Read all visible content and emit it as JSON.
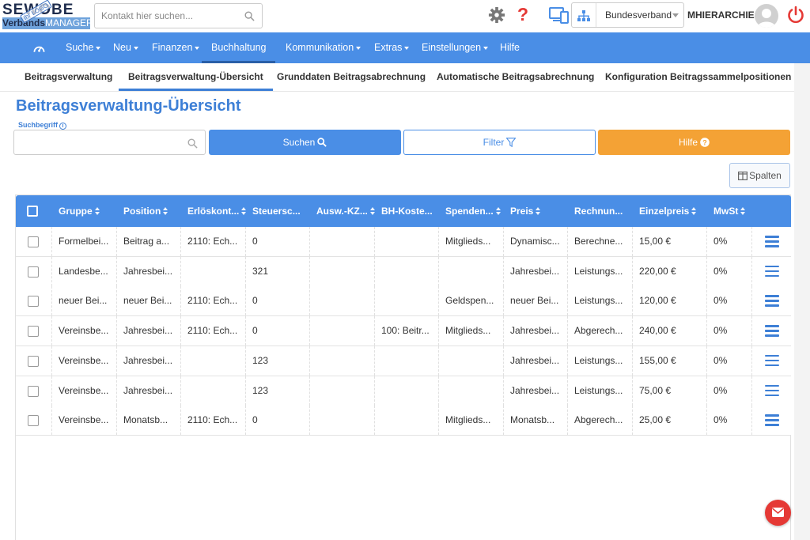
{
  "logo": {
    "top": "SEWOBE",
    "stamp": "Ihr LOGO",
    "bottom_verbands": "Verbands",
    "bottom_manager": "MANAGER"
  },
  "contact_search": {
    "placeholder": "Kontakt hier suchen..."
  },
  "org_select": {
    "value": "Bundesverband"
  },
  "username": "MHIERARCHIE",
  "nav": {
    "items": [
      {
        "label": "Suche",
        "caret": true
      },
      {
        "label": "Neu",
        "caret": true
      },
      {
        "label": "Finanzen",
        "caret": true
      },
      {
        "label": "Buchhaltung",
        "caret": false,
        "active": true
      },
      {
        "label": "Kommunikation",
        "caret": true
      },
      {
        "label": "Extras",
        "caret": true
      },
      {
        "label": "Einstellungen",
        "caret": true
      },
      {
        "label": "Hilfe",
        "caret": false
      }
    ]
  },
  "subtabs": [
    {
      "label": "Beitragsverwaltung"
    },
    {
      "label": "Beitragsverwaltung-Übersicht",
      "active": true
    },
    {
      "label": "Grunddaten Beitragsabrechnung"
    },
    {
      "label": "Automatische Beitragsabrechnung"
    },
    {
      "label": "Konfiguration Beitragssammelpositionen"
    }
  ],
  "page": {
    "title": "Beitragsverwaltung-Übersicht",
    "search_label": "Suchbegriff",
    "search_value": "",
    "btn_search": "Suchen",
    "btn_filter": "Filter",
    "btn_help": "Hilfe",
    "btn_columns": "Spalten"
  },
  "table": {
    "columns": [
      "Gruppe",
      "Position",
      "Erlöskont...",
      "Steuersc...",
      "Ausw.-KZ...",
      "BH-Koste...",
      "Spenden...",
      "Preis",
      "Rechnun...",
      "Einzelpreis",
      "MwSt"
    ],
    "rows": [
      [
        "Formelbei...",
        "Beitrag a...",
        "2110: Ech...",
        "0",
        "",
        "",
        "Mitglieds...",
        "Dynamisc...",
        "Berechne...",
        "15,00 €",
        "0%"
      ],
      [
        "Landesbe...",
        "Jahresbei...",
        "",
        "321",
        "",
        "",
        "",
        "Jahresbei...",
        "Leistungs...",
        "220,00 €",
        "0%"
      ],
      [
        "neuer Bei...",
        "neuer Bei...",
        "2110: Ech...",
        "0",
        "",
        "",
        "Geldspen...",
        "neuer Bei...",
        "Leistungs...",
        "120,00 €",
        "0%"
      ],
      [
        "Vereinsbe...",
        "Jahresbei...",
        "2110: Ech...",
        "0",
        "",
        "100: Beitr...",
        "Mitglieds...",
        "Jahresbei...",
        "Abgerech...",
        "240,00 €",
        "0%"
      ],
      [
        "Vereinsbe...",
        "Jahresbei...",
        "",
        "123",
        "",
        "",
        "",
        "Jahresbei...",
        "Leistungs...",
        "155,00 €",
        "0%"
      ],
      [
        "Vereinsbe...",
        "Jahresbei...",
        "",
        "123",
        "",
        "",
        "",
        "Jahresbei...",
        "Leistungs...",
        "75,00 €",
        "0%"
      ],
      [
        "Vereinsbe...",
        "Monatsb...",
        "2110: Ech...",
        "0",
        "",
        "",
        "Mitglieds...",
        "Monatsb...",
        "Abgerech...",
        "25,00 €",
        "0%"
      ]
    ]
  },
  "colors": {
    "primary": "#4a8ee6",
    "title": "#3d7fd6",
    "help": "#f4a235",
    "danger": "#e53935"
  }
}
